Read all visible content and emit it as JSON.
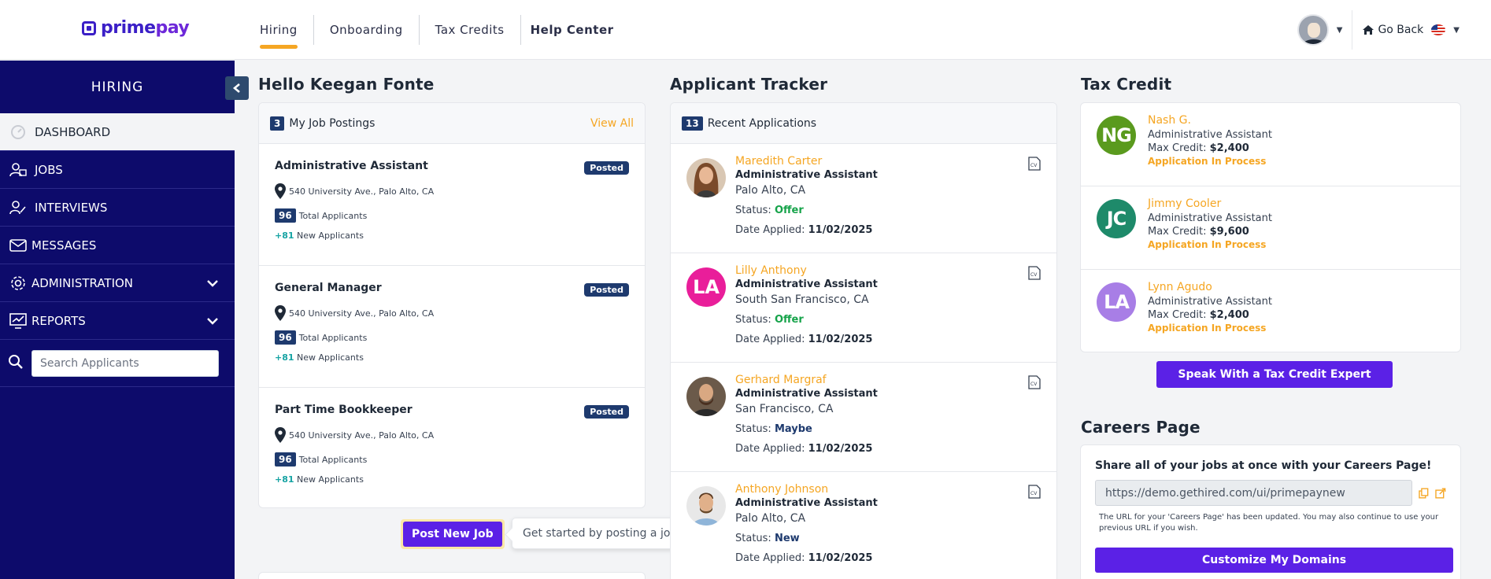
{
  "brand": {
    "name_a": "prime",
    "name_b": "pay"
  },
  "topnav": {
    "tabs": [
      {
        "label": "Hiring",
        "active": true
      },
      {
        "label": "Onboarding"
      },
      {
        "label": "Tax Credits"
      },
      {
        "label": "Help Center"
      }
    ],
    "go_back": "Go Back"
  },
  "sidebar": {
    "title": "HIRING",
    "items": [
      {
        "label": "DASHBOARD",
        "icon": "dashboard-icon"
      },
      {
        "label": "JOBS",
        "icon": "jobs-icon"
      },
      {
        "label": "INTERVIEWS",
        "icon": "interviews-icon"
      },
      {
        "label": "MESSAGES",
        "icon": "envelope-icon"
      },
      {
        "label": "ADMINISTRATION",
        "icon": "gear-icon"
      },
      {
        "label": "REPORTS",
        "icon": "chart-icon"
      }
    ],
    "search_placeholder": "Search Applicants"
  },
  "greeting": "Hello Keegan Fonte",
  "job_postings": {
    "count": "3",
    "title": "My Job Postings",
    "view_all": "View All",
    "items": [
      {
        "title": "Administrative Assistant",
        "badge": "Posted",
        "location": "540 University Ave., Palo Alto, CA",
        "total": "96",
        "total_label": "Total Applicants",
        "new": "+81",
        "new_label": "New Applicants"
      },
      {
        "title": "General Manager",
        "badge": "Posted",
        "location": "540 University Ave., Palo Alto, CA",
        "total": "96",
        "total_label": "Total Applicants",
        "new": "+81",
        "new_label": "New Applicants"
      },
      {
        "title": "Part Time Bookkeeper",
        "badge": "Posted",
        "location": "540 University Ave., Palo Alto, CA",
        "total": "96",
        "total_label": "Total Applicants",
        "new": "+81",
        "new_label": "New Applicants"
      }
    ],
    "post_button": "Post New Job",
    "tooltip": "Get started by posting a job."
  },
  "tracker": {
    "title": "Applicant Tracker",
    "count": "13",
    "head": "Recent Applications",
    "status_label": "Status:",
    "date_label": "Date Applied:",
    "items": [
      {
        "name": "Maredith Carter",
        "role": "Administrative Assistant",
        "city": "Palo Alto, CA",
        "status": "Offer",
        "date": "11/02/2025",
        "photo": "woman-brown-hair"
      },
      {
        "name": "Lilly Anthony",
        "role": "Administrative Assistant",
        "city": "South San Francisco, CA",
        "status": "Offer",
        "date": "11/02/2025",
        "initials": "LA",
        "color": "#e91e9a"
      },
      {
        "name": "Gerhard Margraf",
        "role": "Administrative Assistant",
        "city": "San Francisco, CA",
        "status": "Maybe",
        "date": "11/02/2025",
        "photo": "man-beard"
      },
      {
        "name": "Anthony Johnson",
        "role": "Administrative Assistant",
        "city": "Palo Alto, CA",
        "status": "New",
        "date": "11/02/2025",
        "photo": "man-smiling"
      }
    ]
  },
  "tax_credit": {
    "title": "Tax Credit",
    "max_label": "Max Credit:",
    "items": [
      {
        "initials": "NG",
        "color": "#5a9a1e",
        "name": "Nash G.",
        "role": "Administrative Assistant",
        "credit": "$2,400",
        "status": "Application In Process"
      },
      {
        "initials": "JC",
        "color": "#1e8a6a",
        "name": "Jimmy Cooler",
        "role": "Administrative Assistant",
        "credit": "$9,600",
        "status": "Application In Process"
      },
      {
        "initials": "LA",
        "color": "#a87ee6",
        "name": "Lynn Agudo",
        "role": "Administrative Assistant",
        "credit": "$2,400",
        "status": "Application In Process"
      }
    ],
    "expert_button": "Speak With a Tax Credit Expert"
  },
  "careers": {
    "title": "Careers Page",
    "lead": "Share all of your jobs at once with your Careers Page!",
    "url": "https://demo.gethired.com/ui/primepaynew",
    "note": "The URL for your 'Careers Page' has been updated. You may also continue to use your previous URL if you wish.",
    "customize_button": "Customize My Domains"
  },
  "colors": {
    "sidebar": "#0d0b6b",
    "accent": "#f5a623",
    "primary": "#5b21e6",
    "badge": "#1e3a6e"
  }
}
